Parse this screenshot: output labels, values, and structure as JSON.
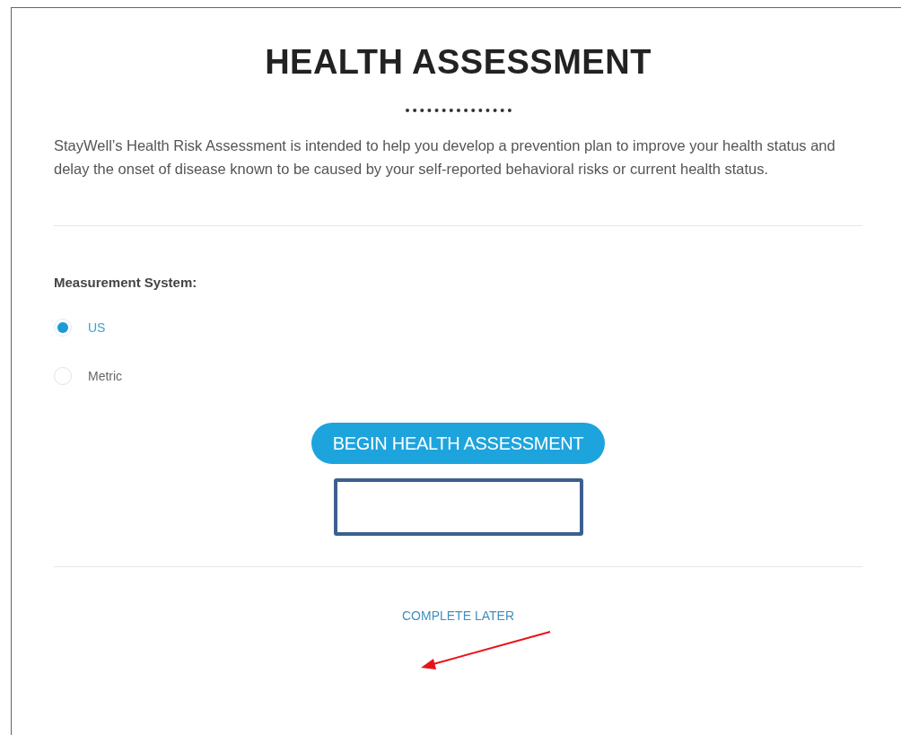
{
  "title": "HEALTH ASSESSMENT",
  "intro": "StayWell’s Health Risk Assessment is intended to help you develop a prevention plan to improve your health status and delay the onset of disease known to be caused by your self-reported behavioral risks or current health status.",
  "measurement": {
    "label": "Measurement System:",
    "options": [
      {
        "label": "US",
        "selected": true
      },
      {
        "label": "Metric",
        "selected": false
      }
    ]
  },
  "begin_button": "BEGIN HEALTH ASSESSMENT",
  "complete_later": "COMPLETE LATER"
}
